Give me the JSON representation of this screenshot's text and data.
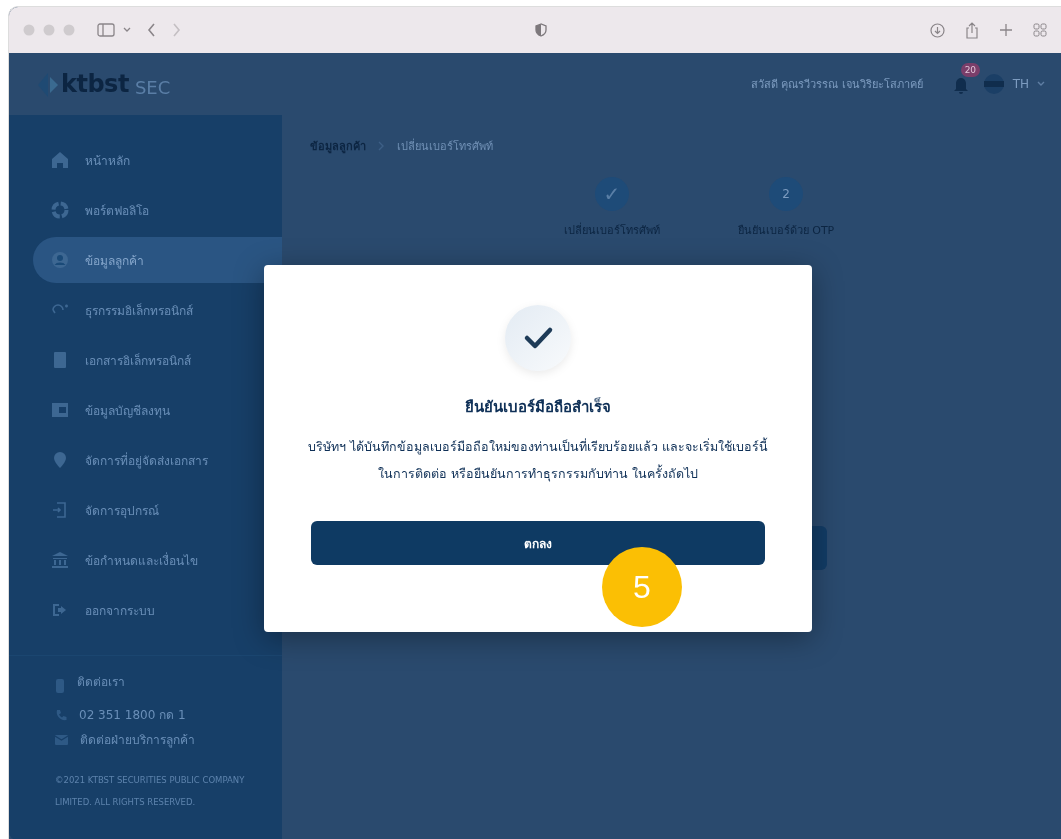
{
  "header": {
    "logo": "ktbst",
    "logo_suffix": "SEC",
    "greeting": "สวัสดี คุณรวีวรรณ เจนวิริยะโสภาคย์",
    "notification_count": "20",
    "language": "TH"
  },
  "sidebar": {
    "items": [
      {
        "label": "หน้าหลัก",
        "selected": false
      },
      {
        "label": "พอร์ตฟอลิโอ",
        "selected": false
      },
      {
        "label": "ข้อมูลลูกค้า",
        "selected": true
      },
      {
        "label": "ธุรกรรมอิเล็กทรอนิกส์",
        "selected": false
      },
      {
        "label": "เอกสารอิเล็กทรอนิกส์",
        "selected": false
      },
      {
        "label": "ข้อมูลบัญชีลงทุน",
        "selected": false
      },
      {
        "label": "จัดการที่อยู่จัดส่งเอกสาร",
        "selected": false
      },
      {
        "label": "จัดการอุปกรณ์",
        "selected": false
      },
      {
        "label": "ข้อกำหนดและเงื่อนไข",
        "selected": false
      },
      {
        "label": "ออกจากระบบ",
        "selected": false
      }
    ],
    "contact_title": "ติดต่อเรา",
    "phone": "02 351 1800 กด 1",
    "email": "ติดต่อฝ่ายบริการลูกค้า",
    "copyright": "©2021 KTBST SECURITIES PUBLIC COMPANY LIMITED. ALL RIGHTS RESERVED."
  },
  "breadcrumb": [
    "ข้อมูลลูกค้า",
    "เปลี่ยนเบอร์โทรศัพท์"
  ],
  "steps": [
    {
      "marker": "✓",
      "label": "เปลี่ยนเบอร์โทรศัพท์",
      "done": true
    },
    {
      "marker": "2",
      "label": "ยืนยันเบอร์ด้วย OTP",
      "done": false
    }
  ],
  "dialog": {
    "title": "ยืนยันเบอร์มือถือสำเร็จ",
    "message": "บริษัทฯ ได้บันทึกข้อมูลเบอร์มือถือใหม่ของท่านเป็นที่เรียบร้อยแล้ว และจะเริ่มใช้เบอร์นี้\nในการติดต่อ หรือยืนยันการทำธุรกรรมกับท่าน ในครั้งถัดไป",
    "button": "ตกลง"
  },
  "callout": "5"
}
